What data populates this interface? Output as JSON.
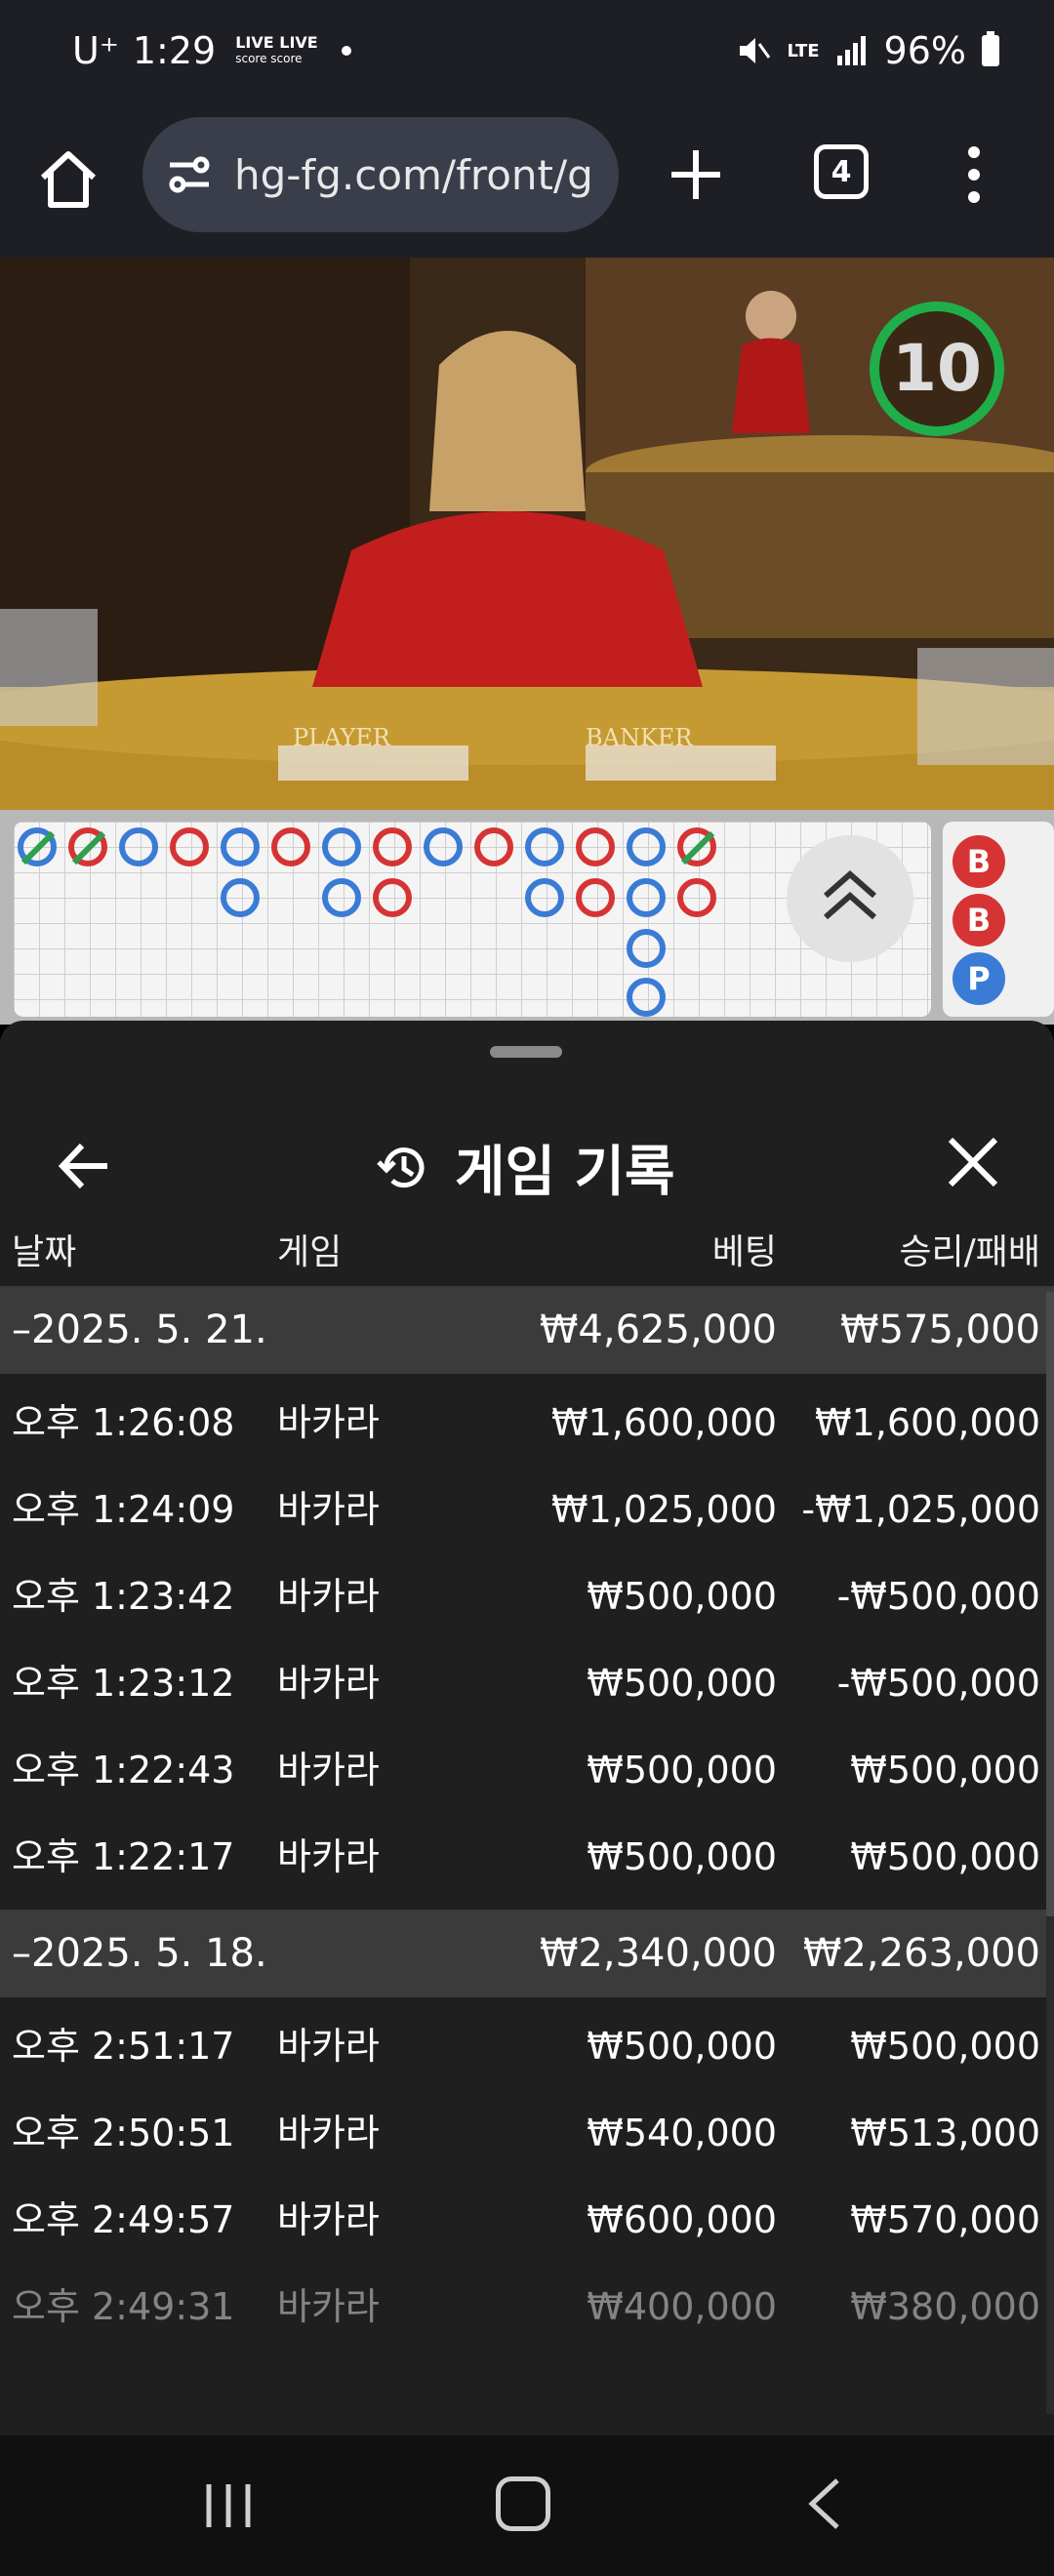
{
  "status_bar": {
    "carrier": "U⁺",
    "time": "1:29",
    "live_line1": "LIVE LIVE",
    "live_line2": "score score",
    "network": "LTE",
    "battery": "96%"
  },
  "browser": {
    "url": "hg-fg.com/front/g",
    "tab_count": "4"
  },
  "video": {
    "timer": "10",
    "player_label": "PLAYER",
    "banker_label": "BANKER"
  },
  "road": {
    "side_labels": [
      "B",
      "B",
      "P"
    ]
  },
  "sheet": {
    "title": "게임 기록",
    "columns": {
      "date": "날짜",
      "game": "게임",
      "bet": "베팅",
      "result": "승리/패배"
    },
    "groups": [
      {
        "date": "–2025. 5. 21.",
        "bet_total": "₩4,625,000",
        "result_total": "₩575,000",
        "rows": [
          {
            "time": "오후 1:26:08",
            "game": "바카라",
            "bet": "₩1,600,000",
            "result": "₩1,600,000"
          },
          {
            "time": "오후 1:24:09",
            "game": "바카라",
            "bet": "₩1,025,000",
            "result": "-₩1,025,000"
          },
          {
            "time": "오후 1:23:42",
            "game": "바카라",
            "bet": "₩500,000",
            "result": "-₩500,000"
          },
          {
            "time": "오후 1:23:12",
            "game": "바카라",
            "bet": "₩500,000",
            "result": "-₩500,000"
          },
          {
            "time": "오후 1:22:43",
            "game": "바카라",
            "bet": "₩500,000",
            "result": "₩500,000"
          },
          {
            "time": "오후 1:22:17",
            "game": "바카라",
            "bet": "₩500,000",
            "result": "₩500,000"
          }
        ]
      },
      {
        "date": "–2025. 5. 18.",
        "bet_total": "₩2,340,000",
        "result_total": "₩2,263,000",
        "rows": [
          {
            "time": "오후 2:51:17",
            "game": "바카라",
            "bet": "₩500,000",
            "result": "₩500,000"
          },
          {
            "time": "오후 2:50:51",
            "game": "바카라",
            "bet": "₩540,000",
            "result": "₩513,000"
          },
          {
            "time": "오후 2:49:57",
            "game": "바카라",
            "bet": "₩600,000",
            "result": "₩570,000"
          },
          {
            "time": "오후 2:49:31",
            "game": "바카라",
            "bet": "₩400,000",
            "result": "₩380,000"
          }
        ]
      }
    ]
  },
  "colors": {
    "player_blue": "#3a7bd5",
    "banker_red": "#d63434",
    "timer_green": "#1fae4a",
    "tie_green": "#2e9e4f"
  }
}
